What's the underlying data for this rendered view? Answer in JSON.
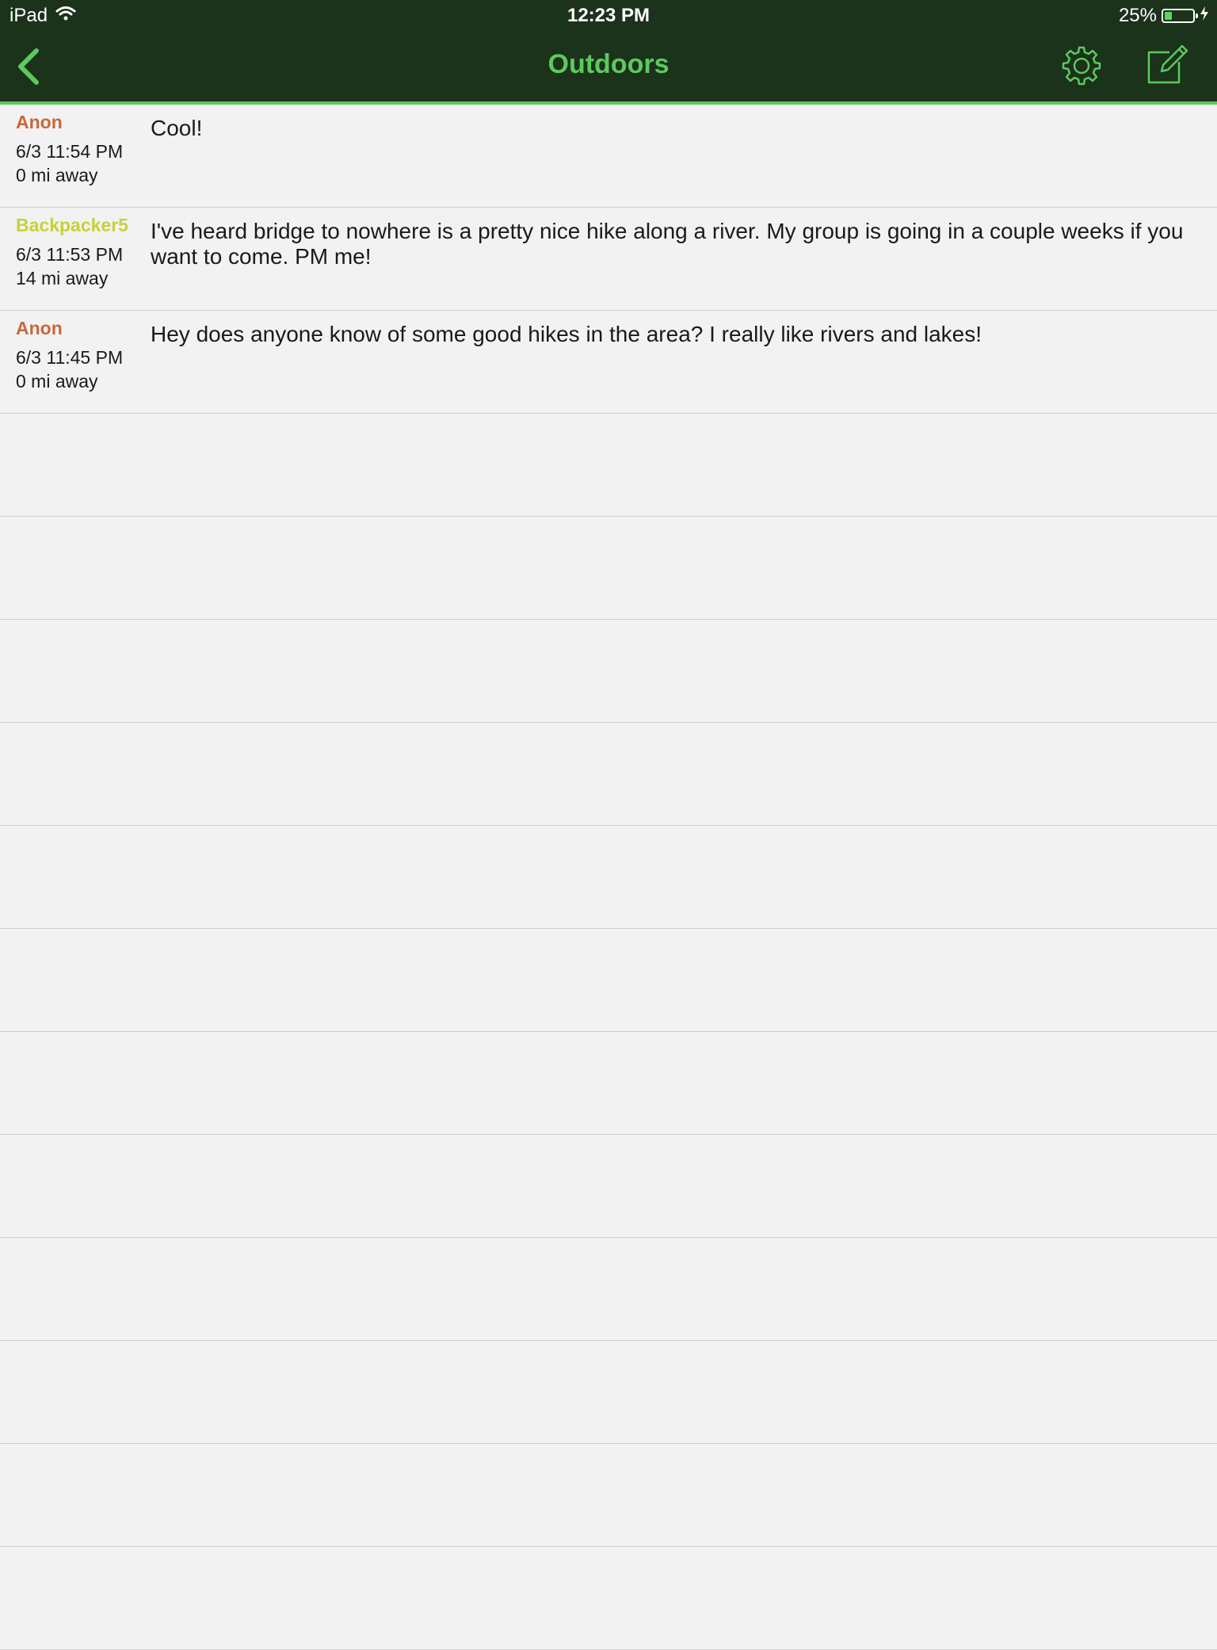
{
  "status_bar": {
    "device": "iPad",
    "time": "12:23 PM",
    "battery_percent": "25%",
    "battery_level": 0.25
  },
  "nav": {
    "title": "Outdoors",
    "accent_color": "#5cc95c",
    "background_color": "#1b321b",
    "icons": {
      "back": "chevron-left-icon",
      "settings": "gear-icon",
      "compose": "compose-icon"
    }
  },
  "posts": [
    {
      "author": "Anon",
      "author_color": "#c8683a",
      "time": "6/3 11:54 PM",
      "distance": "0 mi away",
      "message": "Cool!"
    },
    {
      "author": "Backpacker5",
      "author_color": "#c6d23a",
      "time": "6/3 11:53 PM",
      "distance": "14 mi away",
      "message": "I've heard bridge to nowhere is a pretty nice hike along a river. My group is going in a couple weeks if you want to come. PM me!"
    },
    {
      "author": "Anon",
      "author_color": "#c8683a",
      "time": "6/3 11:45 PM",
      "distance": "0 mi away",
      "message": "Hey does anyone know of some good hikes in the area? I really like rivers and lakes!"
    }
  ]
}
